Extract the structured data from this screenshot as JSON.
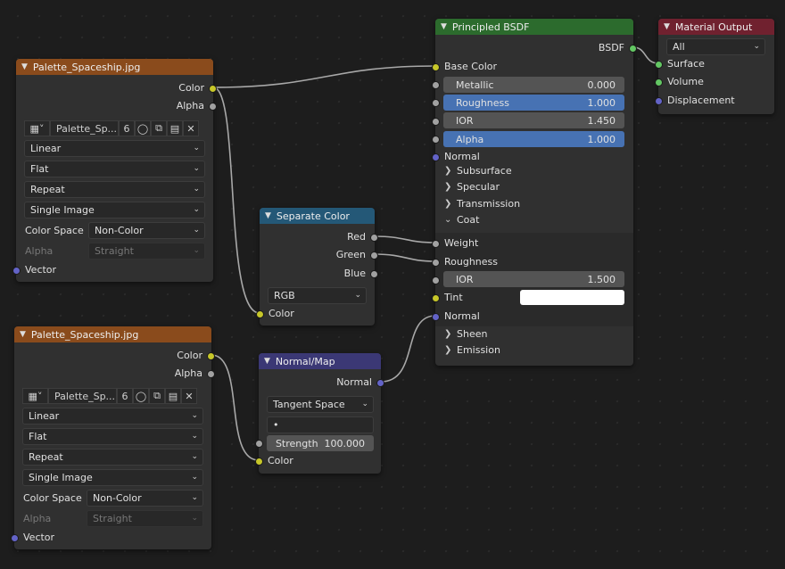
{
  "tex1": {
    "title": "Palette_Spaceship.jpg",
    "out_color": "Color",
    "out_alpha": "Alpha",
    "image_name": "Palette_Sp...",
    "users": "6",
    "interpolation": "Linear",
    "projection": "Flat",
    "extension": "Repeat",
    "source": "Single Image",
    "color_space_label": "Color Space",
    "color_space": "Non-Color",
    "alpha_label": "Alpha",
    "alpha_mode": "Straight",
    "in_vector": "Vector"
  },
  "tex2": {
    "title": "Palette_Spaceship.jpg",
    "out_color": "Color",
    "out_alpha": "Alpha",
    "image_name": "Palette_Sp...",
    "users": "6",
    "interpolation": "Linear",
    "projection": "Flat",
    "extension": "Repeat",
    "source": "Single Image",
    "color_space_label": "Color Space",
    "color_space": "Non-Color",
    "alpha_label": "Alpha",
    "alpha_mode": "Straight",
    "in_vector": "Vector"
  },
  "separate": {
    "title": "Separate Color",
    "out_red": "Red",
    "out_green": "Green",
    "out_blue": "Blue",
    "mode": "RGB",
    "in_color": "Color"
  },
  "normalmap": {
    "title": "Normal/Map",
    "out_normal": "Normal",
    "space": "Tangent Space",
    "uv": "•",
    "strength_label": "Strength",
    "strength_value": "100.000",
    "in_color": "Color"
  },
  "bsdf": {
    "title": "Principled BSDF",
    "out_bsdf": "BSDF",
    "base_color": "Base Color",
    "metallic": {
      "label": "Metallic",
      "value": "0.000"
    },
    "roughness": {
      "label": "Roughness",
      "value": "1.000"
    },
    "ior": {
      "label": "IOR",
      "value": "1.450"
    },
    "alpha": {
      "label": "Alpha",
      "value": "1.000"
    },
    "normal": "Normal",
    "panels": {
      "subsurface": "Subsurface",
      "specular": "Specular",
      "transmission": "Transmission",
      "coat": "Coat",
      "sheen": "Sheen",
      "emission": "Emission"
    },
    "coat": {
      "weight": "Weight",
      "roughness": "Roughness",
      "ior": {
        "label": "IOR",
        "value": "1.500"
      },
      "tint": "Tint",
      "normal": "Normal"
    }
  },
  "output": {
    "title": "Material Output",
    "target": "All",
    "surface": "Surface",
    "volume": "Volume",
    "displacement": "Displacement"
  },
  "colors": {
    "texture_header": "#8a4b1c",
    "converter_header": "#245877",
    "vector_header": "#3b3875",
    "shader_header": "#2c6b2d",
    "output_header": "#70212f",
    "socket_color": "#c7c729",
    "socket_float": "#a1a1a1",
    "socket_vector": "#6363c7",
    "socket_shader": "#63c763",
    "slider_blue": "#4772b3"
  }
}
